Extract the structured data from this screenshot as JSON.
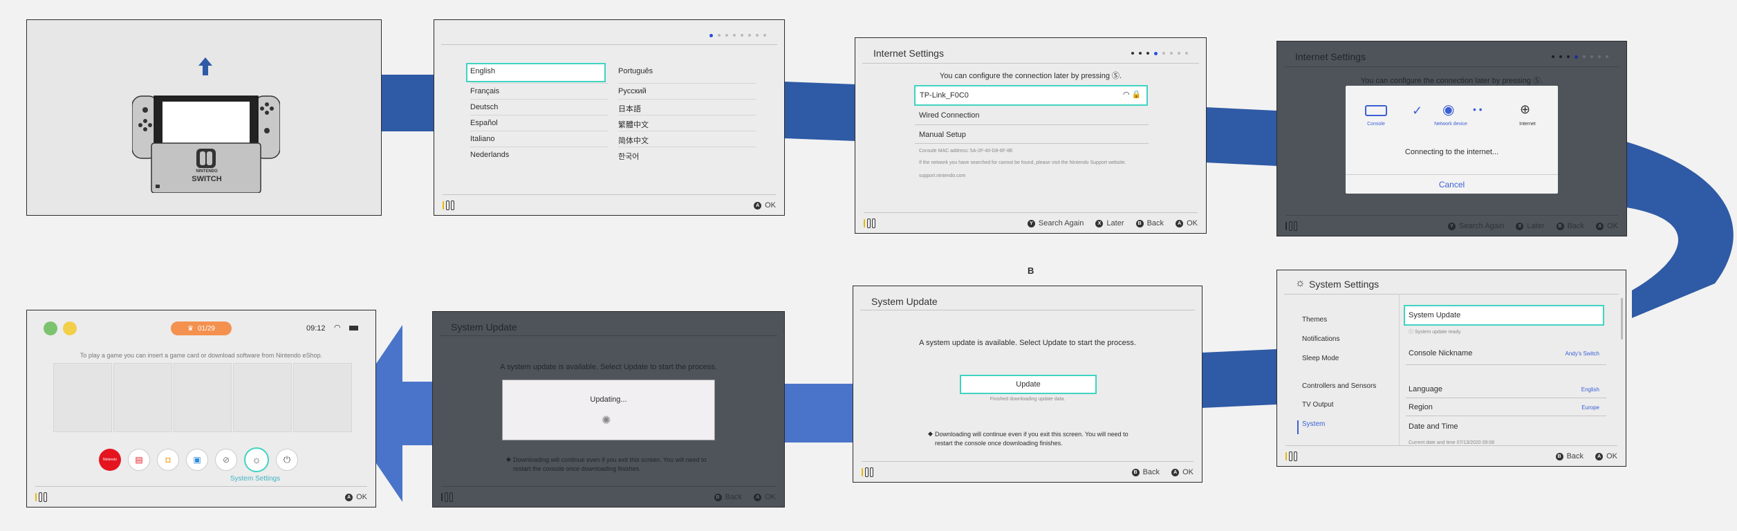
{
  "colors": {
    "accent_blue": "#2f5aa5",
    "cyan_select": "#3fd3c2",
    "dark_overlay": "#4f545b"
  },
  "section_label": "B",
  "panel1": {
    "icon": "arrow-up-icon",
    "console_logo_top": "NINTENDO",
    "console_logo_bottom": "SWITCH"
  },
  "panel2": {
    "languages_left": [
      "English",
      "Français",
      "Deutsch",
      "Español",
      "Italiano",
      "Nederlands"
    ],
    "languages_right": [
      "Português",
      "Русский",
      "日本語",
      "繁體中文",
      "简体中文",
      "한국어"
    ],
    "footer_ok": "OK"
  },
  "panel3": {
    "title": "Internet Settings",
    "instruction": "You can configure the connection later by pressing Ⓢ.",
    "network_selected": "TP-Link_F0C0",
    "wired": "Wired Connection",
    "manual": "Manual Setup",
    "mac": "Console MAC address: 5A-2F-40-D8-6F-8E",
    "note": "If the network you have searched for cannot be found, please visit the Nintendo Support website.",
    "support_url": "support.nintendo.com",
    "footer": {
      "search": "Search Again",
      "later": "Later",
      "back": "Back",
      "ok": "OK"
    }
  },
  "panel4": {
    "title": "Internet Settings",
    "instruction": "You can configure the connection later by pressing Ⓢ.",
    "console_label": "Console",
    "network_label": "Network device",
    "internet_label": "Internet",
    "status": "Connecting to the internet...",
    "cancel": "Cancel",
    "footer": {
      "search": "Search Again",
      "later": "Later",
      "back": "Back",
      "ok": "OK"
    }
  },
  "panel5": {
    "title": "System Settings",
    "nav": [
      "Themes",
      "Notifications",
      "Sleep Mode",
      "Controllers and Sensors",
      "TV Output",
      "System"
    ],
    "system_update": "System Update",
    "system_update_sub": "ⓘ System update ready.",
    "nickname_label": "Console Nickname",
    "nickname_value": "Andy's Switch",
    "language_label": "Language",
    "language_value": "English",
    "region_label": "Region",
    "region_value": "Europe",
    "datetime_label": "Date and Time",
    "datetime_sub": "Current date and time 07/13/2020 09:08",
    "footer": {
      "back": "Back",
      "ok": "OK"
    }
  },
  "panel6": {
    "title": "System Update",
    "message": "A system update is available. Select Update to start the process.",
    "button": "Update",
    "sub": "Finished downloading update data.",
    "note_line1": "Downloading will continue even if you exit this screen. You will need to",
    "note_line2": "restart the console once downloading finishes.",
    "footer": {
      "back": "Back",
      "ok": "OK"
    }
  },
  "panel7": {
    "title": "System Update",
    "message": "A system update is available. Select Update to start the process.",
    "status": "Updating...",
    "note_line1": "Downloading will continue even if you exit this screen. You will need to",
    "note_line2": "restart the console once downloading finishes.",
    "footer": {
      "back": "Back",
      "ok": "OK"
    }
  },
  "panel8": {
    "badge": "01/29",
    "time": "09:12",
    "hint": "To play a game you can insert a game card or download software from Nintendo eShop.",
    "selected_label": "System Settings",
    "nso_label": "Nintendo",
    "footer_ok": "OK"
  }
}
